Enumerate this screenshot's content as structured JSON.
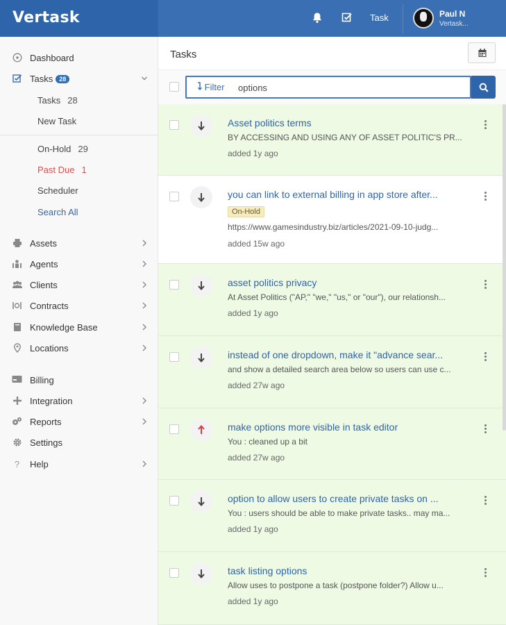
{
  "brand": {
    "logo_text": "Vertask"
  },
  "header": {
    "task_label": "Task",
    "user_name": "Paul N",
    "user_org": "Vertask..."
  },
  "sidebar": {
    "dashboard": "Dashboard",
    "tasks_label": "Tasks",
    "tasks_badge": "28",
    "tasks_sub": {
      "label": "Tasks",
      "count": "28"
    },
    "new_task": "New Task",
    "on_hold": {
      "label": "On-Hold",
      "count": "29"
    },
    "past_due": {
      "label": "Past Due",
      "count": "1"
    },
    "scheduler": "Scheduler",
    "search_all": "Search All",
    "assets": "Assets",
    "agents": "Agents",
    "clients": "Clients",
    "contracts": "Contracts",
    "knowledge_base": "Knowledge Base",
    "locations": "Locations",
    "billing": "Billing",
    "integration": "Integration",
    "reports": "Reports",
    "settings": "Settings",
    "help": "Help"
  },
  "main": {
    "title": "Tasks",
    "filter_label": "Filter",
    "search_value": "options"
  },
  "tasks": [
    {
      "title": "Asset politics terms",
      "status": "",
      "desc": "BY ACCESSING AND USING ANY OF ASSET POLITIC'S PR...",
      "date": "added 1y ago",
      "priority": "down"
    },
    {
      "title": "you can link to external billing in app store after...",
      "status": "On-Hold",
      "desc": "https://www.gamesindustry.biz/articles/2021-09-10-judg...",
      "date": "added 15w ago",
      "priority": "down"
    },
    {
      "title": "asset politics privacy",
      "status": "",
      "desc": "At Asset Politics (\"AP,\" \"we,\" \"us,\" or \"our\"), our relationsh...",
      "date": "added 1y ago",
      "priority": "down"
    },
    {
      "title": "instead of one dropdown, make it \"advance sear...",
      "status": "",
      "desc": "and show a detailed search area below so users can use c...",
      "date": "added 27w ago",
      "priority": "down"
    },
    {
      "title": "make options more visible in task editor",
      "status": "",
      "desc": "You : cleaned up a bit",
      "date": "added 27w ago",
      "priority": "up"
    },
    {
      "title": "option to allow users to create private tasks on ...",
      "status": "",
      "desc": "You : users should be able to make private tasks.. may ma...",
      "date": "added 1y ago",
      "priority": "down"
    },
    {
      "title": "task listing options",
      "status": "",
      "desc": "Allow uses to postpone a task (postpone folder?) Allow u...",
      "date": "added 1y ago",
      "priority": "down"
    }
  ],
  "colors": {
    "header_bg": "#3a6fb3",
    "accent": "#2e64aa",
    "row_green": "#eefae4",
    "past_due_red": "#e04b4b",
    "priority_up": "#e03a3a"
  }
}
